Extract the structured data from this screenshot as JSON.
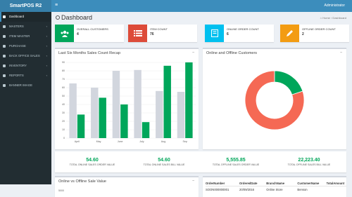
{
  "app": {
    "brand": "SmartPOS R2",
    "user": "Administrator"
  },
  "sidebar": {
    "items": [
      {
        "label": "Dashboard",
        "active": true
      },
      {
        "label": "MASTERS",
        "chevron": "‹"
      },
      {
        "label": "ITEM MASTER",
        "chevron": "‹"
      },
      {
        "label": "PURCHASE",
        "chevron": "‹"
      },
      {
        "label": "BACK OFFICE SALES",
        "chevron": "‹"
      },
      {
        "label": "INVENTORY",
        "chevron": "‹"
      },
      {
        "label": "REPORTS",
        "chevron": "‹"
      },
      {
        "label": "BANNER IMAGE"
      }
    ]
  },
  "page": {
    "title": "Dashboard",
    "breadcrumb": "⌂ Home › Dashboard"
  },
  "info_boxes": [
    {
      "label": "OVERALL CUSTOMERS",
      "value": "4",
      "color": "#00a65a",
      "icon": "users-icon"
    },
    {
      "label": "ITEM COUNT",
      "value": "76",
      "color": "#dd4b39",
      "icon": "list-icon"
    },
    {
      "label": "ONLINE ORDER COUNT",
      "value": "6",
      "color": "#00c0ef",
      "icon": "book-icon"
    },
    {
      "label": "OFFLINE ORDER COUNT",
      "value": "2",
      "color": "#f39c12",
      "icon": "pencil-icon"
    }
  ],
  "sales_chart": {
    "title": "Last Six Months Sales Count Recap",
    "collapse": "‒",
    "chart_data": {
      "type": "bar",
      "categories": [
        "April",
        "May",
        "June",
        "July",
        "Aug",
        "Sep"
      ],
      "series": [
        {
          "values": [
            65,
            60,
            80,
            81,
            56,
            55
          ],
          "color": "#d2d6de"
        },
        {
          "values": [
            28,
            48,
            40,
            19,
            86,
            90
          ],
          "color": "#00a65a"
        }
      ],
      "ylim": [
        0,
        90
      ],
      "yticks": [
        0,
        10,
        20,
        30,
        40,
        50,
        60,
        70,
        80,
        90
      ]
    }
  },
  "donut_chart": {
    "title": "Online and Offline Customers",
    "collapse": "‒",
    "chart_data": {
      "type": "pie",
      "slices": [
        {
          "value": 80,
          "color": "#f56954"
        },
        {
          "value": 20,
          "color": "#00a65a"
        }
      ]
    }
  },
  "stats": [
    {
      "value": "54.60",
      "label": "TOTAL ONLINE SALES ORDER VALUE"
    },
    {
      "value": "54.60",
      "label": "TOTAL ONLINE SALES BILL VALUE"
    },
    {
      "value": "5,555.85",
      "label": "TOTAL OFFLINE SALES ORDER VALUE"
    },
    {
      "value": "22,223.40",
      "label": "TOTAL OFFLINE SALES BILL VALUE"
    }
  ],
  "online_offline": {
    "title": "Online vs Offline Sale Value",
    "collapse": "‒",
    "axis_tick": "5000"
  },
  "orders_table": {
    "headers": [
      "OrderNumber",
      "OrderedDate",
      "BranchName",
      "CustomerName",
      "TotalAmount"
    ],
    "rows": [
      [
        "SOON000000001",
        "20/09/2016",
        "Online Store",
        "Benson",
        ""
      ]
    ]
  }
}
